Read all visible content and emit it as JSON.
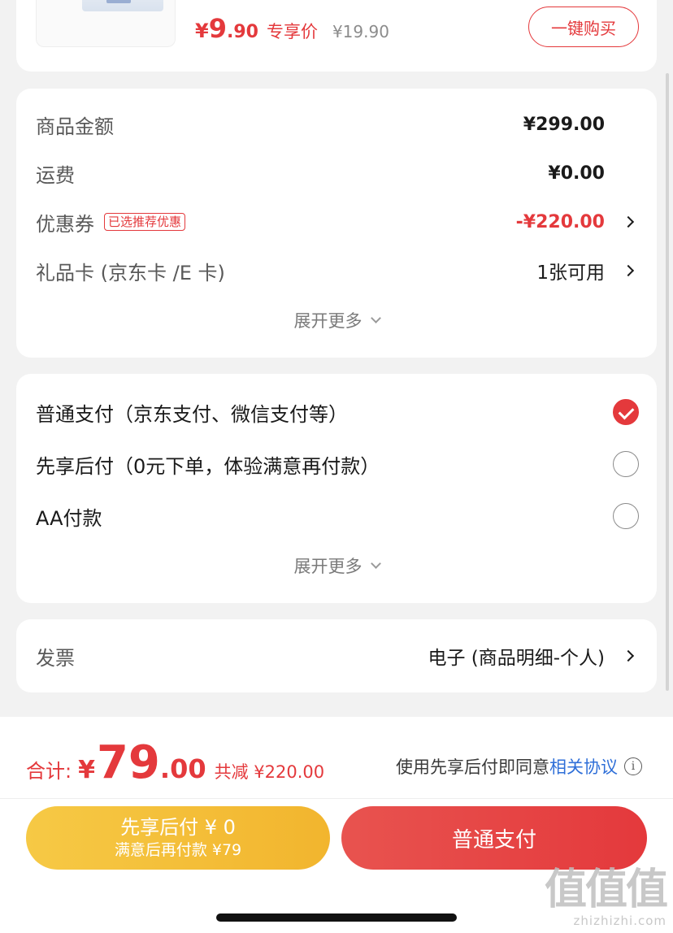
{
  "product": {
    "price_currency": "¥",
    "price_int": "9",
    "price_dec": ".90",
    "price_tag": "专享价",
    "original_price": "¥19.90",
    "buy_button": "一键购买"
  },
  "summary": {
    "rows": [
      {
        "label": "商品金额",
        "value": "¥299.00"
      },
      {
        "label": "运费",
        "value": "¥0.00"
      },
      {
        "label": "优惠券",
        "badge": "已选推荐优惠",
        "value": "-¥220.00"
      },
      {
        "label": "礼品卡 (京东卡 /E 卡)",
        "value": "1张可用"
      }
    ],
    "expand_label": "展开更多"
  },
  "payment": {
    "options": [
      {
        "label": "普通支付（京东支付、微信支付等）",
        "selected": true
      },
      {
        "label": "先享后付（0元下单，体验满意再付款）",
        "selected": false
      },
      {
        "label": "AA付款",
        "selected": false
      }
    ],
    "expand_label": "展开更多"
  },
  "invoice": {
    "label": "发票",
    "value": "电子 (商品明细-个人)"
  },
  "footer": {
    "total_label": "合计:",
    "total_currency": "¥",
    "total_int": "79",
    "total_dec": ".00",
    "saved": "共减 ¥220.00",
    "agree_text": "使用先享后付即同意",
    "agree_link": "相关协议",
    "btn_later_line1": "先享后付 ¥ 0",
    "btn_later_line2": "满意后再付款 ¥79",
    "btn_normal": "普通支付"
  },
  "watermark": {
    "big": "值值值",
    "small": "zhizhizhi.com"
  },
  "colors": {
    "accent_red": "#e4393c",
    "accent_yellow": "#f4be38",
    "link_blue": "#2f6fd8"
  }
}
